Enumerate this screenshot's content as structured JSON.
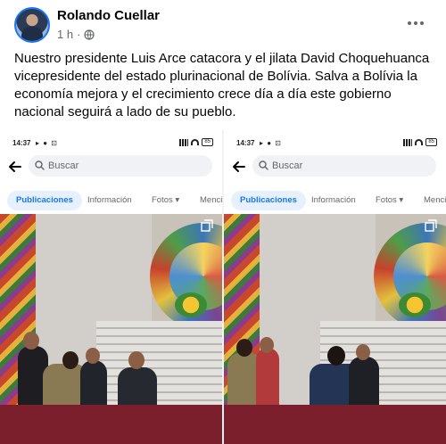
{
  "post": {
    "author": "Rolando Cuellar",
    "time": "1 h",
    "separator": "·",
    "text": "Nuestro presidente Luis Arce catacora y el jilata David Choquehuanca vicepresidente del estado plurinacional de Bolívia.  Salva a Bolívia la economía mejora y el crecimiento crece día a día este gobierno nacional seguirá a lado de su pueblo."
  },
  "screenshots": [
    {
      "status": {
        "time": "14:37",
        "icons": "▸ ● ⊡",
        "battery": "85"
      },
      "search_placeholder": "Buscar",
      "tabs": [
        "Publicaciones",
        "Información",
        "Fotos ▾",
        "Menci"
      ]
    },
    {
      "status": {
        "time": "14:37",
        "icons": "▸ ● ⊡",
        "battery": "85"
      },
      "search_placeholder": "Buscar",
      "tabs": [
        "Publicaciones",
        "Información",
        "Fotos ▾",
        "Menci"
      ]
    }
  ],
  "colors": {
    "accent": "#1877f2",
    "secondary_text": "#65676b"
  },
  "icons": {
    "more": "more-horizontal-icon",
    "privacy": "globe-icon",
    "back": "back-arrow-icon",
    "search": "search-icon",
    "expand": "expand-icon"
  }
}
